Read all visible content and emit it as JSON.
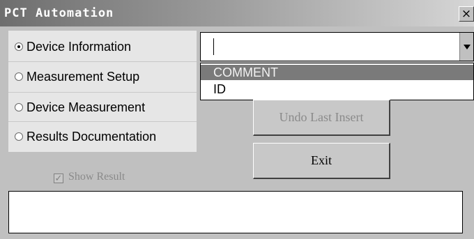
{
  "window": {
    "title": "PCT Automation",
    "close_label": "×"
  },
  "radio_options": [
    {
      "label": "Device Information",
      "selected": true
    },
    {
      "label": "Measurement Setup",
      "selected": false
    },
    {
      "label": "Device Measurement",
      "selected": false
    },
    {
      "label": "Results Documentation",
      "selected": false
    }
  ],
  "show_result": {
    "label": "Show Result",
    "checked": true,
    "enabled": false,
    "check_mark": "✓"
  },
  "combo": {
    "value": "",
    "options": [
      "COMMENT",
      "ID"
    ],
    "highlighted": "COMMENT"
  },
  "buttons": {
    "undo_label": "Undo Last Insert",
    "exit_label": "Exit"
  },
  "output": {
    "text": ""
  }
}
